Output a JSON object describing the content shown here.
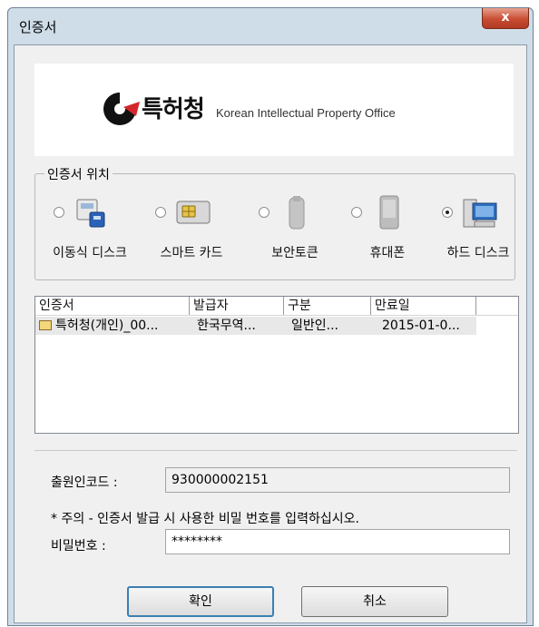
{
  "window": {
    "title": "인증서",
    "close_label": "x"
  },
  "banner": {
    "logo_text": "특허청",
    "logo_english": "Korean Intellectual Property Office"
  },
  "location_group": {
    "legend": "인증서 위치",
    "devices": [
      {
        "label": "이동식 디스크",
        "icon": "usb-disk-icon",
        "selected": false
      },
      {
        "label": "스마트 카드",
        "icon": "smart-card-icon",
        "selected": false
      },
      {
        "label": "보안토큰",
        "icon": "security-token-icon",
        "selected": false
      },
      {
        "label": "휴대폰",
        "icon": "mobile-phone-icon",
        "selected": false
      },
      {
        "label": "하드 디스크",
        "icon": "hard-disk-icon",
        "selected": true
      }
    ]
  },
  "cert_list": {
    "columns": [
      "인증서",
      "발급자",
      "구분",
      "만료일"
    ],
    "rows": [
      {
        "name": "특허청(개인)_00...",
        "issuer": "한국무역...",
        "type": "일반인...",
        "expiry": "2015-01-0..."
      }
    ]
  },
  "form": {
    "applicant_code_label": "출원인코드 :",
    "applicant_code_value": "930000002151",
    "notice": "* 주의 - 인증서 발급 시 사용한 비밀 번호를 입력하십시오.",
    "password_label": "비밀번호 :",
    "password_value": "********"
  },
  "buttons": {
    "ok": "확인",
    "cancel": "취소"
  }
}
